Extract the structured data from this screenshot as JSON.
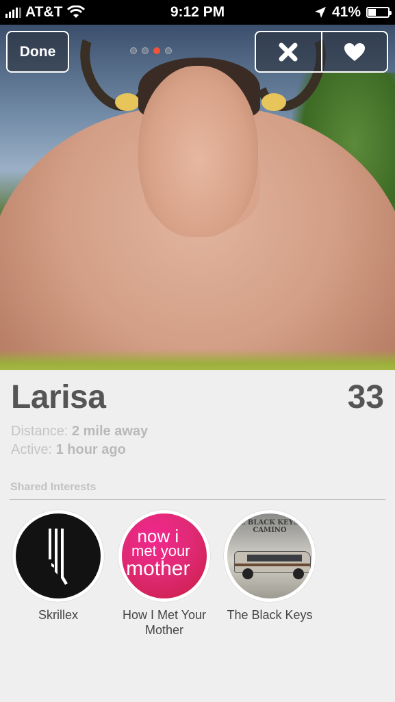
{
  "status_bar": {
    "carrier": "AT&T",
    "time": "9:12 PM",
    "battery": "41%",
    "battery_level": 0.41,
    "signal_bars": 4
  },
  "header": {
    "done_label": "Done",
    "photo_pages": 4,
    "active_photo_index": 3
  },
  "profile": {
    "name": "Larisa",
    "age": "33",
    "distance_label": "Distance:",
    "distance_value": "2 mile away",
    "active_label": "Active:",
    "active_value": "1 hour ago"
  },
  "shared_interests": {
    "title": "Shared Interests",
    "items": [
      {
        "label": "Skrillex"
      },
      {
        "label": "How I Met Your Mother",
        "art_lines": [
          "now i",
          "met your",
          "mother"
        ]
      },
      {
        "label": "The Black Keys",
        "art_text": "THE BLACK KEYS EL CAMINO"
      }
    ]
  },
  "colors": {
    "accent_dot": "#f0553b",
    "name_text": "#555555",
    "meta_text": "#c4c4c4"
  }
}
